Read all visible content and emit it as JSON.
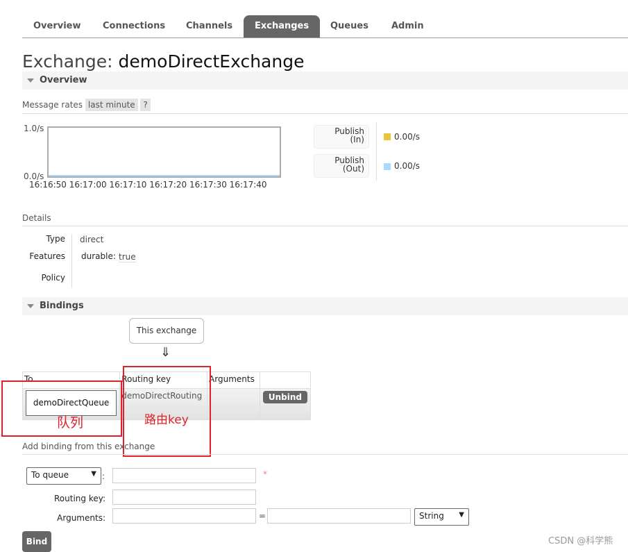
{
  "nav": {
    "tabs": [
      {
        "label": "Overview"
      },
      {
        "label": "Connections"
      },
      {
        "label": "Channels"
      },
      {
        "label": "Exchanges",
        "active": true
      },
      {
        "label": "Queues"
      },
      {
        "label": "Admin"
      }
    ]
  },
  "page": {
    "title_prefix": "Exchange:",
    "title_name": "demoDirectExchange"
  },
  "overview": {
    "heading": "Overview",
    "message_rates_label": "Message rates",
    "range": "last minute",
    "help": "?",
    "chart": {
      "y_max": "1.0/s",
      "y_min": "0.0/s",
      "x_ticks": [
        "16:16:50",
        "16:17:00",
        "16:17:10",
        "16:17:20",
        "16:17:30",
        "16:17:40"
      ]
    },
    "legend": [
      {
        "label_line1": "Publish",
        "label_line2": "(In)",
        "value": "0.00/s",
        "color": "#edc240"
      },
      {
        "label_line1": "Publish",
        "label_line2": "(Out)",
        "value": "0.00/s",
        "color": "#afd8f8"
      }
    ]
  },
  "details": {
    "heading": "Details",
    "type_label": "Type",
    "type_value": "direct",
    "features_label": "Features",
    "feature_key": "durable:",
    "feature_value": "true",
    "policy_label": "Policy"
  },
  "bindings": {
    "heading": "Bindings",
    "source": "This exchange",
    "arrow": "⇓",
    "columns": [
      "To",
      "Routing key",
      "Arguments",
      ""
    ],
    "rows": [
      {
        "to": "demoDirectQueue",
        "routing_key": "demoDirectRouting",
        "arguments": "",
        "action": "Unbind"
      }
    ],
    "annotations": {
      "queue": "队列",
      "routing_key": "路由key"
    }
  },
  "add_binding": {
    "heading": "Add binding from this exchange",
    "destination_type": "To queue",
    "required_mark": "*",
    "routing_key_label": "Routing key:",
    "arguments_label": "Arguments:",
    "equals": "=",
    "arg_type": "String",
    "colon": ":",
    "bind_label": "Bind"
  },
  "watermark": "CSDN @科学熊"
}
